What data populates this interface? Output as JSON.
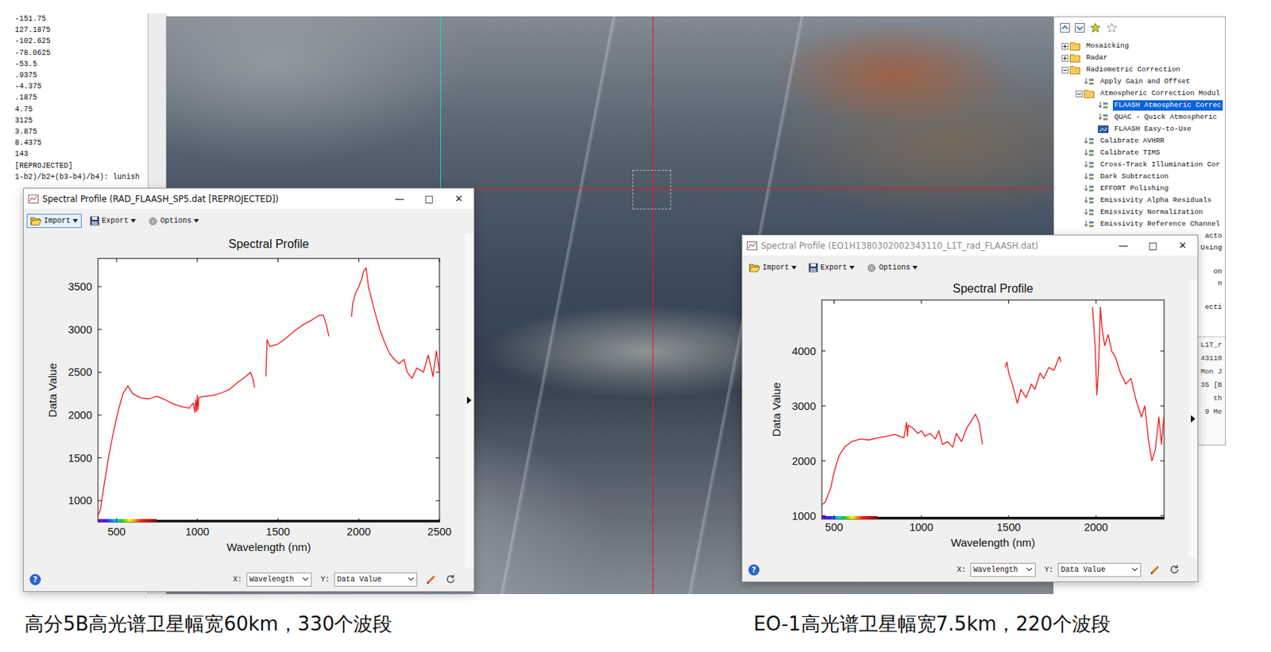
{
  "left_panel": {
    "lines": [
      "-151.75",
      "127.1875",
      "-102.625",
      "-78.0625",
      "-53.5",
      ".9375",
      "-4.375",
      ".1875",
      "4.75",
      "3125",
      "3.875",
      "8.4375",
      "143",
      "[REPROJECTED]",
      "1-b2)/b2+(b3-b4)/b4): lunish"
    ]
  },
  "tree": {
    "items": [
      {
        "label": "Mosaicking",
        "kind": "folder",
        "level": 0,
        "expanded": false,
        "selected": false
      },
      {
        "label": "Radar",
        "kind": "folder",
        "level": 0,
        "expanded": false,
        "selected": false
      },
      {
        "label": "Radiometric Correction",
        "kind": "folder",
        "level": 0,
        "expanded": true,
        "selected": false
      },
      {
        "label": "Apply Gain and Offset",
        "kind": "tool",
        "level": 1,
        "expanded": false,
        "selected": false
      },
      {
        "label": "Atmospheric Correction Modul",
        "kind": "folder",
        "level": 1,
        "expanded": true,
        "selected": false
      },
      {
        "label": "FLAASH Atmospheric Correc",
        "kind": "tool",
        "level": 2,
        "expanded": false,
        "selected": true
      },
      {
        "label": "QUAC - Quick Atmospheric",
        "kind": "tool",
        "level": 2,
        "expanded": false,
        "selected": false
      },
      {
        "label": "FLAASH Easy-to-Use",
        "kind": "wizard",
        "level": 2,
        "expanded": false,
        "selected": false
      },
      {
        "label": "Calibrate AVHRR",
        "kind": "tool",
        "level": 1,
        "expanded": false,
        "selected": false
      },
      {
        "label": "Calibrate TIMS",
        "kind": "tool",
        "level": 1,
        "expanded": false,
        "selected": false
      },
      {
        "label": "Cross-Track Illumination Cor",
        "kind": "tool",
        "level": 1,
        "expanded": false,
        "selected": false
      },
      {
        "label": "Dark Subtraction",
        "kind": "tool",
        "level": 1,
        "expanded": false,
        "selected": false
      },
      {
        "label": "EFFORT Polishing",
        "kind": "tool",
        "level": 1,
        "expanded": false,
        "selected": false
      },
      {
        "label": "Emissivity Alpha Residuals",
        "kind": "tool",
        "level": 1,
        "expanded": false,
        "selected": false
      },
      {
        "label": "Emissivity Normalization",
        "kind": "tool",
        "level": 1,
        "expanded": false,
        "selected": false
      },
      {
        "label": "Emissivity Reference Channel",
        "kind": "tool",
        "level": 1,
        "expanded": false,
        "selected": false
      }
    ],
    "fragments": [
      "acto",
      "Using",
      "",
      "on",
      "n",
      "",
      "ecti"
    ]
  },
  "info_panel": {
    "lines": [
      "L1T_r",
      "43110",
      "Mon J",
      "35 [B",
      "th",
      "9 Me"
    ]
  },
  "windows": [
    {
      "title": "Spectral Profile (RAD_FLAASH_SP5.dat [REPROJECTED])",
      "active": true,
      "controls": [
        "—",
        "□",
        "✕"
      ],
      "toolbar": [
        {
          "label": "Import",
          "highlighted": true
        },
        {
          "label": "Export",
          "highlighted": false
        },
        {
          "label": "Options",
          "highlighted": false
        }
      ],
      "chart": {
        "title": "Spectral Profile",
        "x_label": "Wavelength (nm)",
        "y_label": "Data Value",
        "x_range": [
          385,
          2500
        ],
        "y_range": [
          750,
          3830
        ],
        "x_ticks": [
          "500",
          "1000",
          "1500",
          "2000",
          "2500"
        ],
        "y_ticks": [
          "1000",
          "1500",
          "2000",
          "2500",
          "3000",
          "3500"
        ],
        "segments": [
          {
            "wavelengths": [
              385,
              400,
              420,
              450,
              480,
              510,
              540,
              570,
              600,
              650,
              700,
              750,
              800,
              850,
              900,
              950,
              975,
              985,
              990,
              995,
              1000,
              1005,
              1010,
              1020,
              1050,
              1100,
              1150,
              1200,
              1250,
              1300,
              1330,
              1345,
              1355
            ],
            "values": [
              820,
              900,
              1150,
              1500,
              1800,
              2050,
              2250,
              2340,
              2250,
              2200,
              2190,
              2220,
              2180,
              2130,
              2100,
              2080,
              2140,
              2030,
              2180,
              2040,
              2230,
              2060,
              2200,
              2210,
              2220,
              2230,
              2260,
              2300,
              2380,
              2450,
              2500,
              2420,
              2320
            ]
          },
          {
            "wavelengths": [
              1425,
              1432,
              1450,
              1500,
              1550,
              1600,
              1650,
              1700,
              1750,
              1780,
              1800,
              1815
            ],
            "values": [
              2450,
              2880,
              2800,
              2830,
              2900,
              2980,
              3050,
              3100,
              3160,
              3170,
              3050,
              2920
            ]
          },
          {
            "wavelengths": [
              1955,
              1962,
              1980,
              2000,
              2020,
              2030,
              2045,
              2060,
              2080,
              2100,
              2130,
              2160,
              2190,
              2220,
              2250,
              2280,
              2300,
              2330,
              2360,
              2400,
              2430,
              2460,
              2480,
              2500
            ],
            "values": [
              3150,
              3300,
              3420,
              3500,
              3600,
              3680,
              3720,
              3500,
              3350,
              3200,
              3000,
              2850,
              2720,
              2650,
              2600,
              2650,
              2500,
              2430,
              2550,
              2500,
              2700,
              2450,
              2750,
              2500
            ]
          }
        ]
      },
      "help": "?",
      "x_select": {
        "label": "X:",
        "value": "Wavelength"
      },
      "y_select": {
        "label": "Y:",
        "value": "Data Value"
      }
    },
    {
      "title": "Spectral Profile (EO1H1380302002343110_L1T_rad_FLAASH.dat)",
      "active": false,
      "controls": [
        "—",
        "□",
        "✕"
      ],
      "toolbar": [
        {
          "label": "Import",
          "highlighted": false
        },
        {
          "label": "Export",
          "highlighted": false
        },
        {
          "label": "Options",
          "highlighted": false
        }
      ],
      "chart": {
        "title": "Spectral Profile",
        "x_label": "Wavelength (nm)",
        "y_label": "Data Value",
        "x_range": [
          430,
          2390
        ],
        "y_range": [
          940,
          4930
        ],
        "x_ticks": [
          "500",
          "1000",
          "1500",
          "2000"
        ],
        "y_ticks": [
          "1000",
          "2000",
          "3000",
          "4000"
        ],
        "segments": [
          {
            "wavelengths": [
              430,
              450,
              480,
              500,
              530,
              560,
              600,
              650,
              700,
              750,
              800,
              850,
              900,
              915,
              920,
              925,
              950,
              980,
              1000,
              1020,
              1050,
              1080,
              1100,
              1120,
              1150,
              1180,
              1200,
              1230,
              1260,
              1290,
              1310,
              1330,
              1350
            ],
            "values": [
              1200,
              1250,
              1500,
              1800,
              2100,
              2250,
              2350,
              2400,
              2380,
              2420,
              2450,
              2480,
              2420,
              2700,
              2450,
              2650,
              2600,
              2500,
              2550,
              2450,
              2500,
              2400,
              2550,
              2300,
              2350,
              2250,
              2500,
              2350,
              2600,
              2750,
              2850,
              2700,
              2300
            ]
          },
          {
            "wavelengths": [
              1480,
              1490,
              1500,
              1520,
              1550,
              1570,
              1600,
              1630,
              1650,
              1680,
              1700,
              1730,
              1760,
              1790,
              1800
            ],
            "values": [
              3700,
              3800,
              3600,
              3400,
              3050,
              3300,
              3150,
              3400,
              3300,
              3600,
              3500,
              3700,
              3650,
              3900,
              3800
            ]
          },
          {
            "wavelengths": [
              1980,
              1995,
              2005,
              2015,
              2025,
              2035,
              2050,
              2070,
              2090,
              2110,
              2140,
              2170,
              2200,
              2230,
              2260,
              2280,
              2300,
              2320,
              2340,
              2360,
              2375,
              2388
            ],
            "values": [
              4800,
              4100,
              3200,
              3700,
              4800,
              4400,
              4100,
              4300,
              4000,
              3900,
              3600,
              3400,
              3500,
              3100,
              2800,
              3000,
              2400,
              2000,
              2200,
              2800,
              2300,
              2800
            ]
          }
        ]
      },
      "help": "?",
      "x_select": {
        "label": "X:",
        "value": "Wavelength"
      },
      "y_select": {
        "label": "Y:",
        "value": "Data Value"
      }
    }
  ],
  "captions": [
    "高分5B高光谱卫星幅宽60km，330个波段",
    "EO-1高光谱卫星幅宽7.5km，220个波段"
  ]
}
